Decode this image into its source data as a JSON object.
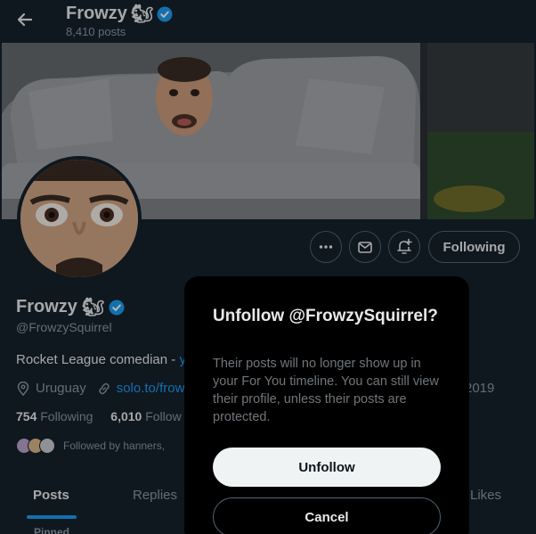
{
  "header": {
    "name": "Frowzy",
    "posts_count": "8,410 posts"
  },
  "profile": {
    "name": "Frowzy",
    "handle": "@FrowzySquirrel",
    "bio_text": "Rocket League comedian - ",
    "bio_link": "y",
    "location": "Uruguay",
    "website": "solo.to/frow",
    "joined_year": "2019",
    "following_count": "754",
    "following_label": "Following",
    "followers_count": "6,010",
    "followers_label": "Follow",
    "followed_by": "Followed by hanners,"
  },
  "actions": {
    "following_label": "Following"
  },
  "tabs": [
    {
      "label": "Posts"
    },
    {
      "label": "Replies"
    },
    {
      "label": "Likes"
    }
  ],
  "pinned_label": "Pinned",
  "dialog": {
    "title": "Unfollow @FrowzySquirrel?",
    "body": "Their posts will no longer show up in your For You timeline. You can still view their profile, unless their posts are protected.",
    "unfollow_label": "Unfollow",
    "cancel_label": "Cancel"
  },
  "colors": {
    "background": "#15202b",
    "accent": "#1d9bf0",
    "dialog_bg": "#000000",
    "verified": "#1d9bf0"
  },
  "icons": {
    "back": "arrow-left-icon",
    "verified": "verified-badge-icon",
    "emoji": "squirrel-emoji",
    "more": "more-dots-icon",
    "message": "envelope-icon",
    "notify": "bell-plus-icon",
    "location": "location-pin-icon",
    "link": "link-icon"
  }
}
